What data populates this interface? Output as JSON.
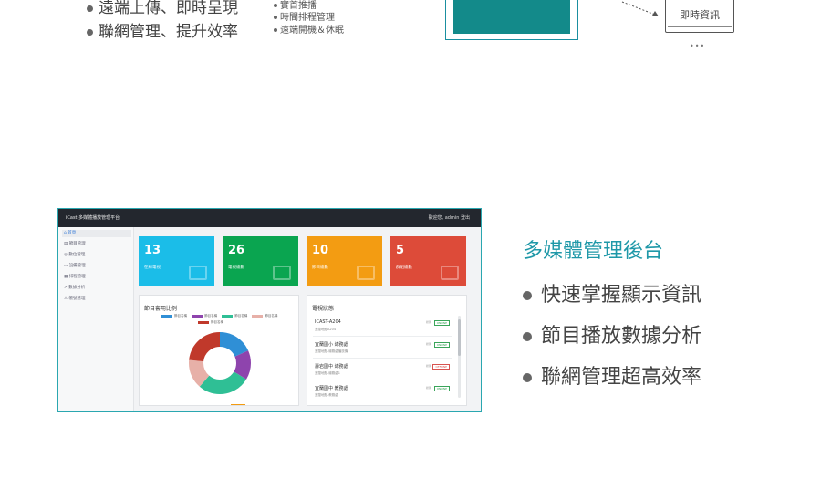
{
  "top": {
    "bullets": [
      "遠端上傳、即時呈現",
      "聯網管理、提升效率"
    ],
    "small_bullets": [
      "實首推播",
      "時間排程管理",
      "遠端開機＆休眠"
    ],
    "device_label": "即時資訊",
    "more_dots": "•••"
  },
  "dashboard": {
    "app_title": "iCast 多媒體播放管理平台",
    "user_text": "歡迎您, admin  登出",
    "sidebar": [
      "首頁",
      "節目管理",
      "數位管理",
      "設備管理",
      "排程管理",
      "數據分析",
      "帳號管理"
    ],
    "cards": [
      {
        "value": "13",
        "label": "在線電視",
        "color": "#1bbde8"
      },
      {
        "value": "26",
        "label": "電視總數",
        "color": "#0aa550"
      },
      {
        "value": "10",
        "label": "節目總數",
        "color": "#f39c12"
      },
      {
        "value": "5",
        "label": "群組總數",
        "color": "#dd4b39"
      }
    ],
    "chart_panel_title": "節目套用比例",
    "chart_legend": [
      "節目名稱",
      "節目名稱",
      "節目名稱",
      "節目名稱",
      "節目名稱"
    ],
    "chart_legend_colors": [
      "#2f8fd6",
      "#8e44ad",
      "#2fbf95",
      "#e7b0a8",
      "#c0392b"
    ],
    "tv_panel_title": "電視狀態",
    "tv_list": [
      {
        "name": "ICAST-A204",
        "sub": "宜蘭地點A204",
        "status": "ONLINE"
      },
      {
        "name": "宜蘭國小 總務處",
        "sub": "宜蘭地點-總務處播放機",
        "status": "ONLINE"
      },
      {
        "name": "壽岩國中 總務處",
        "sub": "宜蘭地點-總務處1",
        "status": "OFFLINE"
      },
      {
        "name": "宜蘭國中 教務處",
        "sub": "宜蘭地點-教務處",
        "status": "ONLINE"
      }
    ],
    "tv_status_label": "狀態"
  },
  "features": {
    "title": "多媒體管理後台",
    "items": [
      "快速掌握顯示資訊",
      "節目播放數據分析",
      "聯網管理超高效率"
    ]
  }
}
